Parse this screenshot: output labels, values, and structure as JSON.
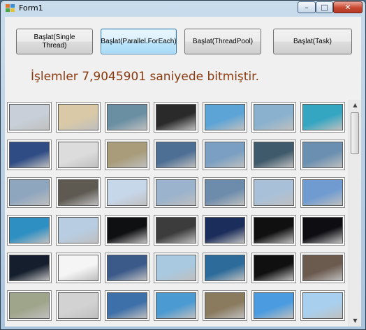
{
  "window": {
    "title": "Form1",
    "controls": {
      "minimize": "–",
      "maximize": "□",
      "close": "✕"
    }
  },
  "buttons": [
    {
      "label": "Başlat(Single Thread)"
    },
    {
      "label": "Başlat(Parallel.ForEach)"
    },
    {
      "label": "Başlat(ThreadPool)"
    },
    {
      "label": "Başlat(Task)"
    }
  ],
  "status": {
    "text": "İşlemler 7,9045901 saniyede bitmiştir."
  },
  "gallery": {
    "thumbnails": [
      "airshow-jets-smoke-icon",
      "black-sports-car-icon",
      "orange-lamborghini-icon",
      "shield-emblem-icon",
      "tropical-beach-icon",
      "sky-clouds-icon",
      "turquoise-sea-icon",
      "runway-jet-icon",
      "cockpit-gauge-icon",
      "fighter-jet-icon",
      "jet-formation-icon",
      "fighter-jet-icon",
      "twin-fighters-icon",
      "helicopter-icon",
      "fighter-jet-icon",
      "bomber-sunset-icon",
      "jet-trails-icon",
      "fighter-jet-icon",
      "fighter-jet-icon",
      "fighter-jet-icon",
      "fighter-jet-icon",
      "ocean-horizon-icon",
      "sky-abstract-icon",
      "saturn-planet-icon",
      "abstract-dark-icon",
      "blue-light-icon",
      "city-skyline-icon",
      "starship-icon",
      "world-map-icon",
      "sketch-icon",
      "earth-orbit-icon",
      "convertible-car-icon",
      "white-sports-car-icon",
      "horse-logo-icon",
      "woman-portrait-icon",
      "green-eye-icon",
      "silver-car-icon",
      "blue-wave-icon",
      "cartoon-icon",
      "cartoon-icon",
      "cartoon-icon",
      "cartoon-icon"
    ],
    "colors": [
      "#c8cfd8",
      "#d9c9a6",
      "#6a8fa3",
      "#2a2a2a",
      "#5da4d6",
      "#8ab2cf",
      "#35a6c2",
      "#2f4c85",
      "#dcdcdc",
      "#a89c7a",
      "#4d6f94",
      "#7a9fc2",
      "#3f5a6b",
      "#6a8fb0",
      "#8fa6bf",
      "#5e5a52",
      "#c7d7ea",
      "#9bb3cc",
      "#6d8cab",
      "#a9c1d8",
      "#6f9bd1",
      "#2e8fc3",
      "#b8cde2",
      "#0f1012",
      "#3c3c3c",
      "#1b2d5a",
      "#101010",
      "#0d0d12",
      "#141e2d",
      "#f5f5f5",
      "#3b5a8a",
      "#a8c9e0",
      "#2c6b9a",
      "#101010",
      "#6b5a4e",
      "#9fa58a",
      "#d2d2d2",
      "#3d6fa8",
      "#4b9ad2",
      "#8a7a5e",
      "#4a9be0",
      "#a8d0ee"
    ]
  }
}
